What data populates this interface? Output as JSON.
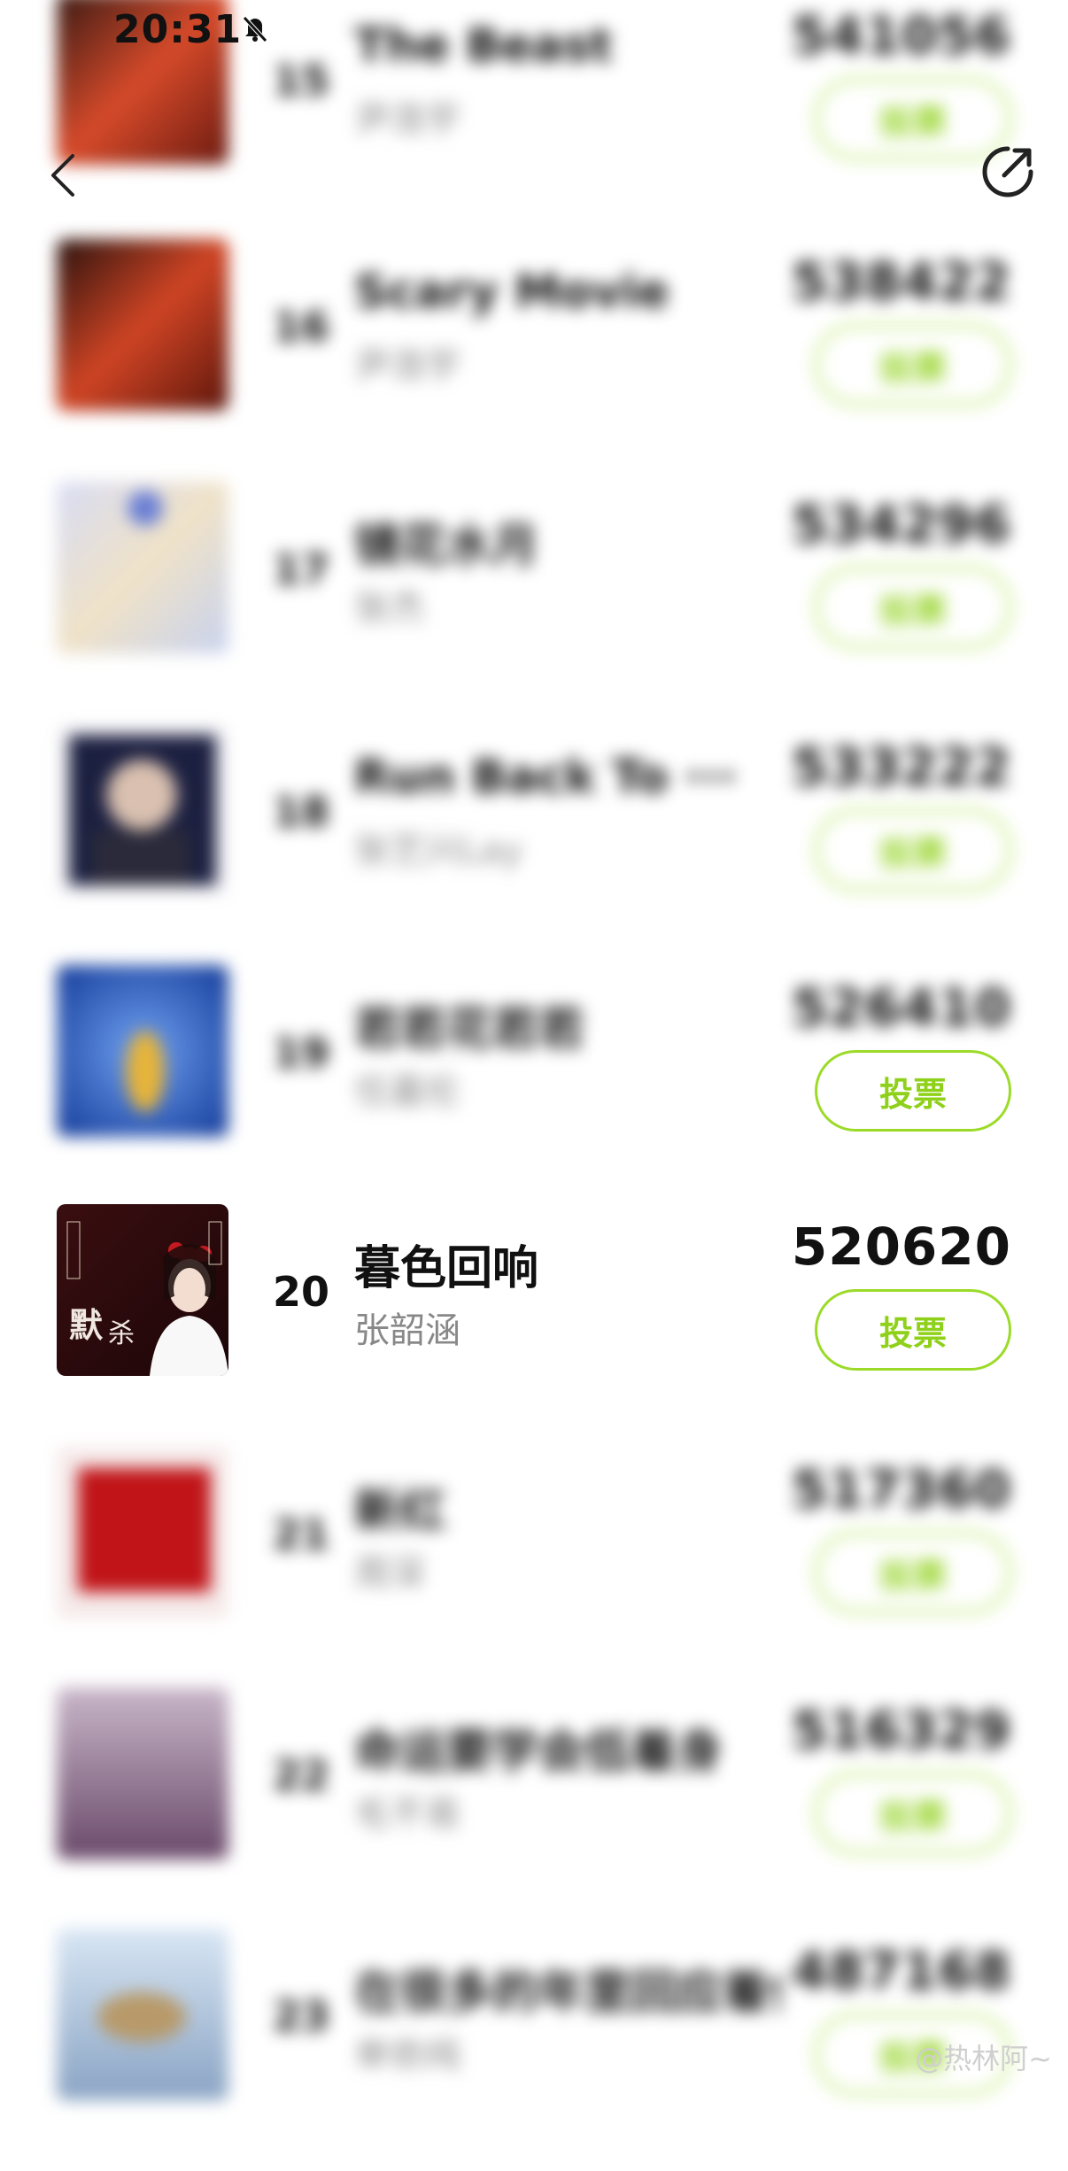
{
  "status_bar": {
    "time": "20:31"
  },
  "accent_color": "#9bdb27",
  "vote_label": "投票",
  "songs": [
    {
      "rank": "15",
      "title": "The Beast",
      "artist": "尹浩宇",
      "votes": "541056",
      "highlighted": false
    },
    {
      "rank": "16",
      "title": "Scary Movie",
      "artist": "尹浩宇",
      "votes": "538422",
      "highlighted": false
    },
    {
      "rank": "17",
      "title": "镜花水月",
      "artist": "张杰",
      "votes": "534296",
      "highlighted": false
    },
    {
      "rank": "18",
      "title": "Run Back To ···",
      "artist": "张艺兴Lay",
      "votes": "533222",
      "highlighted": false
    },
    {
      "rank": "19",
      "title": "若若花若若",
      "artist": "任嘉伦",
      "votes": "526410",
      "highlighted": false
    },
    {
      "rank": "20",
      "title": "暮色回响",
      "artist": "张韶涵",
      "votes": "520620",
      "highlighted": true
    },
    {
      "rank": "21",
      "title": "新红",
      "artist": "周深",
      "votes": "517360",
      "highlighted": false
    },
    {
      "rank": "22",
      "title": "命运要学会低着身",
      "artist": "毛不易",
      "votes": "516329",
      "highlighted": false
    },
    {
      "rank": "23",
      "title": "在很多的年里回应着你",
      "artist": "单依纯",
      "votes": "487168",
      "highlighted": false
    }
  ],
  "watermark": "@热林阿~"
}
